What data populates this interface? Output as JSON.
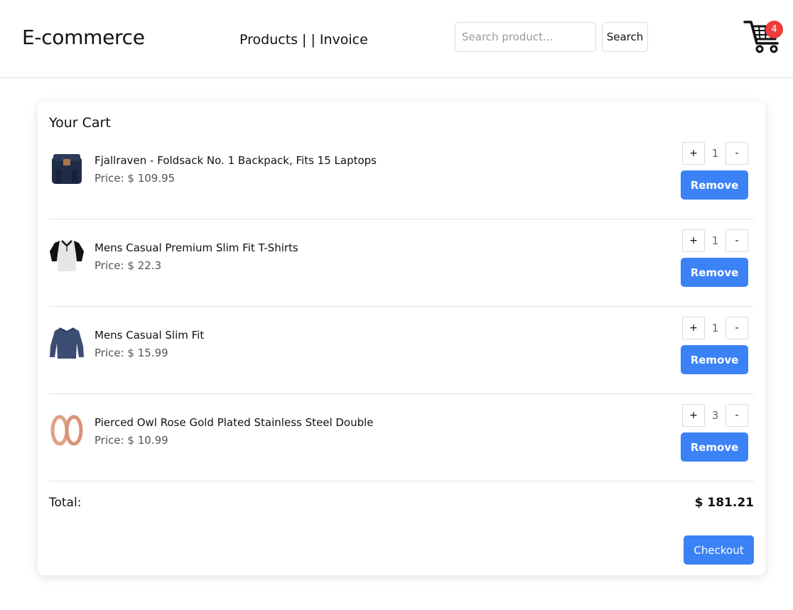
{
  "header": {
    "brand": "E-commerce",
    "nav": {
      "products": "Products",
      "separator": "| |",
      "invoice": "Invoice"
    },
    "search": {
      "placeholder": "Search product...",
      "value": "",
      "button_label": "Search"
    },
    "cart": {
      "count": "4",
      "icon": "shopping-cart-icon",
      "badge_color": "#ef3b3b"
    }
  },
  "cart": {
    "title": "Your Cart",
    "items": [
      {
        "name": "Fjallraven - Foldsack No. 1 Backpack, Fits 15 Laptops",
        "price": "Price: $ 109.95",
        "quantity": "1",
        "plus": "+",
        "minus": "-",
        "remove_label": "Remove",
        "image": "backpack-image"
      },
      {
        "name": "Mens Casual Premium Slim Fit T-Shirts",
        "price": "Price: $ 22.3",
        "quantity": "1",
        "plus": "+",
        "minus": "-",
        "remove_label": "Remove",
        "image": "tshirt-image"
      },
      {
        "name": "Mens Casual Slim Fit",
        "price": "Price: $ 15.99",
        "quantity": "1",
        "plus": "+",
        "minus": "-",
        "remove_label": "Remove",
        "image": "longsleeve-image"
      },
      {
        "name": "Pierced Owl Rose Gold Plated Stainless Steel Double",
        "price": "Price: $ 10.99",
        "quantity": "3",
        "plus": "+",
        "minus": "-",
        "remove_label": "Remove",
        "image": "rings-image"
      }
    ],
    "total_label": "Total:",
    "total_value": "$ 181.21",
    "checkout_label": "Checkout"
  },
  "colors": {
    "accent": "#3b82f6",
    "badge": "#ef3b3b",
    "text": "#111111",
    "muted": "#555555"
  }
}
